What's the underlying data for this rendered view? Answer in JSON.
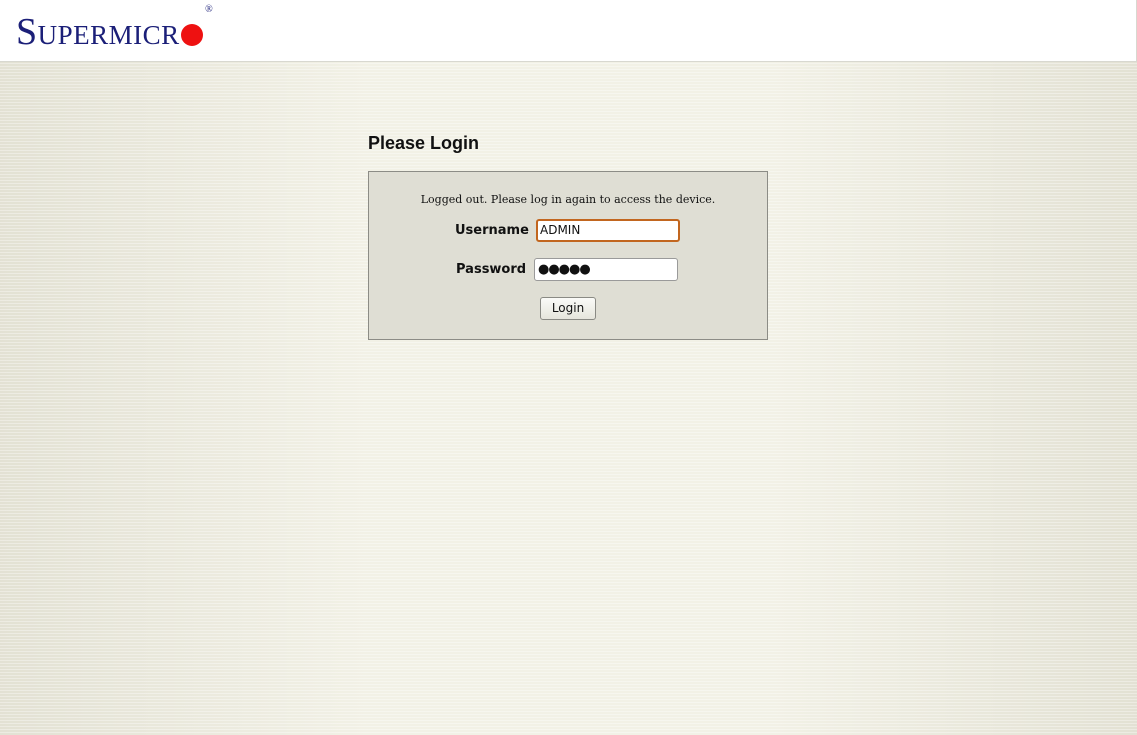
{
  "header": {
    "brand": {
      "first_letter": "S",
      "rest": "UPERMICR",
      "registered": "®",
      "dot_color": "#ee1111",
      "text_color": "#1b1f78"
    }
  },
  "login": {
    "title": "Please Login",
    "message": "Logged out. Please log in again to access the device.",
    "username_label": "Username",
    "username_value": "ADMIN",
    "password_label": "Password",
    "password_masked": "●●●●●",
    "button_label": "Login"
  }
}
